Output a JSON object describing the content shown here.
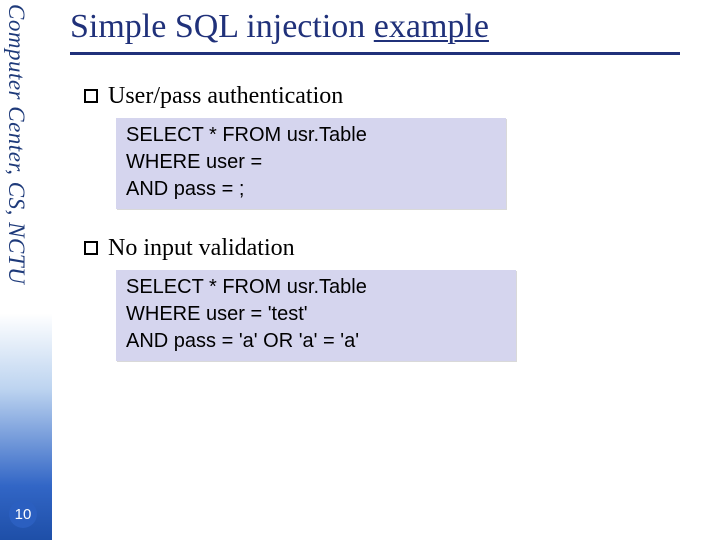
{
  "sidebar": {
    "org_text": "Computer Center, CS, NCTU"
  },
  "page": {
    "number": "10"
  },
  "slide": {
    "title_prefix": "Simple SQL injection ",
    "title_underlined": "example",
    "bullets": [
      {
        "label": "User/pass authentication"
      },
      {
        "label": "No input validation"
      }
    ],
    "code_blocks": [
      "SELECT * FROM usr.Table\nWHERE user = \nAND pass = ;",
      "SELECT * FROM usr.Table\nWHERE user = 'test'\nAND pass = 'a' OR 'a' = 'a'"
    ]
  }
}
